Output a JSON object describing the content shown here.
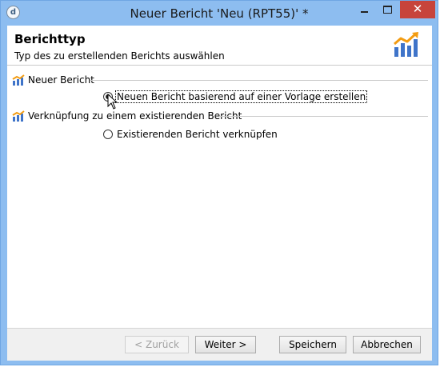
{
  "window": {
    "title": "Neuer Bericht 'Neu (RPT55)' *",
    "app_icon_glyph": "d",
    "close_glyph": "✕"
  },
  "header": {
    "title": "Berichttyp",
    "subtitle": "Typ des zu erstellenden Berichts auswählen"
  },
  "groups": [
    {
      "label": "Neuer Bericht",
      "icon": "report-chart-icon",
      "option": {
        "label": "Neuen Bericht basierend auf einer Vorlage erstellen",
        "checked": true
      }
    },
    {
      "label": "Verknüpfung zu einem existierenden Bericht",
      "icon": "report-chart-icon",
      "option": {
        "label": "Existierenden Bericht verknüpfen",
        "checked": false
      }
    }
  ],
  "buttons": {
    "back": "< Zurück",
    "next": "Weiter >",
    "save": "Speichern",
    "cancel": "Abbrechen"
  },
  "colors": {
    "titlebar": "#8dbdf0",
    "close_button": "#c7443b",
    "chart_orange": "#f39c12",
    "chart_blue": "#3f74c9"
  }
}
